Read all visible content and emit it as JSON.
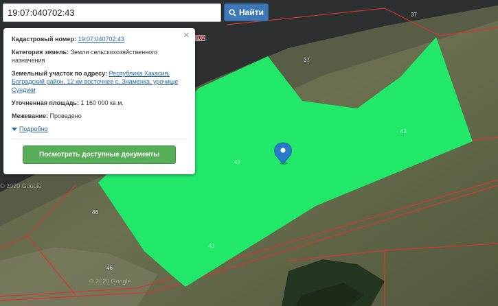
{
  "search": {
    "value": "19:07:040702:43",
    "button_label": "Найти",
    "icon": "search-icon"
  },
  "popup": {
    "close_glyph": "×",
    "cadastral_number_label": "Кадастровый номер:",
    "cadastral_number_value": "19:07:040702:43",
    "category_label": "Категория земель:",
    "category_value": "Земли сельскохозяйственного назначения",
    "address_label": "Земельный участок по адресу:",
    "address_value": "Республика Хакасия, Боградский район, 12 км восточнее с. Знаменка, урочище Сундуки",
    "area_label": "Уточненная площадь:",
    "area_value": "1 160 000 кв.м.",
    "survey_label": "Межевание:",
    "survey_value": "Проведено",
    "more_label": "Подробно",
    "docs_button_label": "Посмотреть доступные документы"
  },
  "map": {
    "parcel_labels": [
      "37",
      "37",
      "43",
      "43",
      "43",
      "46",
      "46"
    ],
    "edge_label": "702",
    "watermark": "© 2020 Google",
    "colors": {
      "parcel_fill": "#22e86a",
      "boundary": "#d8362f",
      "marker": "#2a79c9",
      "terrain": "#4f5a3a",
      "water": "#2c3030"
    }
  }
}
